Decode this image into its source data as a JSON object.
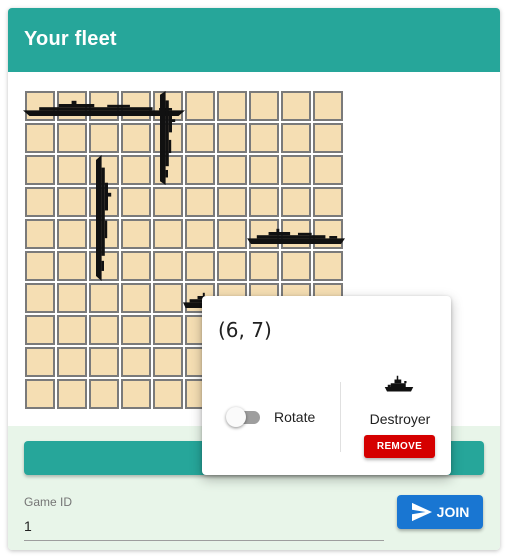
{
  "fleet_panel": {
    "title": "Your fleet",
    "board": {
      "rows": 10,
      "cols": 10
    },
    "ships": [
      {
        "name": "aircraft-carrier",
        "orientation": "horizontal",
        "row": 0,
        "col": 0,
        "length": 5
      },
      {
        "name": "battleship",
        "orientation": "vertical",
        "row": 0,
        "col": 4,
        "length": 3
      },
      {
        "name": "submarine",
        "orientation": "vertical",
        "row": 2,
        "col": 2,
        "length": 4
      },
      {
        "name": "cruiser",
        "orientation": "horizontal",
        "row": 4,
        "col": 7,
        "length": 3
      },
      {
        "name": "destroyer",
        "orientation": "horizontal",
        "row": 6,
        "col": 5,
        "length": 2
      }
    ]
  },
  "ship_popover": {
    "coordinates": "(6, 7)",
    "rotate_label": "Rotate",
    "rotate_on": false,
    "ship_name": "Destroyer",
    "remove_label": "REMOVE"
  },
  "join_section": {
    "game_id_label": "Game ID",
    "game_id_value": "1",
    "join_label": "JOIN"
  },
  "colors": {
    "header": "#26a69a",
    "cell": "#f5deb3",
    "cell_border": "#7a7a7a",
    "footer_bg": "#e8f5e9",
    "join": "#1976d2",
    "remove": "#d50000"
  },
  "icons": [
    "send-icon",
    "destroyer-icon"
  ]
}
